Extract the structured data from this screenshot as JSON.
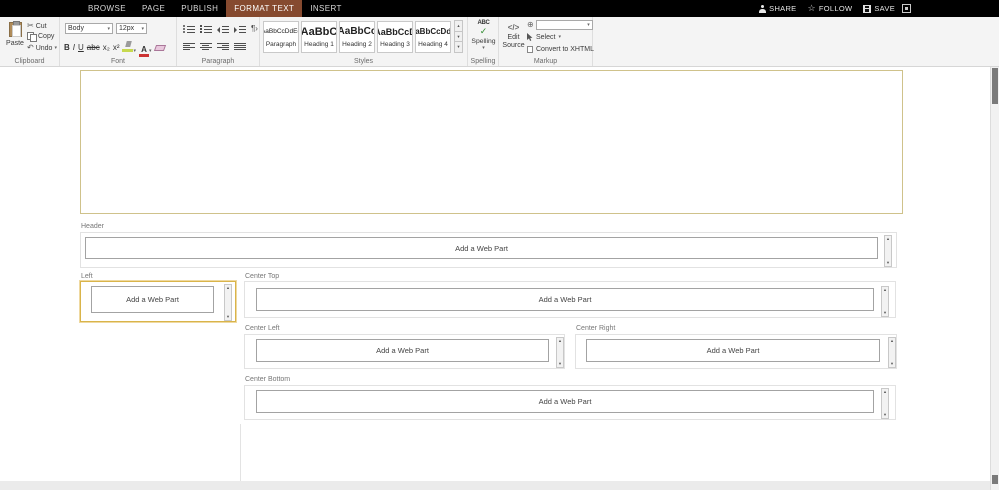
{
  "suite_bar": {
    "tabs": [
      "BROWSE",
      "PAGE",
      "PUBLISH",
      "FORMAT TEXT",
      "INSERT"
    ],
    "active_tab": "FORMAT TEXT",
    "share": "SHARE",
    "follow": "FOLLOW",
    "save": "SAVE"
  },
  "ribbon": {
    "clipboard": {
      "label": "Clipboard",
      "paste": "Paste",
      "cut": "Cut",
      "copy": "Copy",
      "undo": "Undo"
    },
    "font": {
      "label": "Font",
      "family": "Body",
      "size": "12px",
      "bold": "B",
      "italic": "I",
      "underline": "U",
      "strikethrough": "abc",
      "subscript": "x₂",
      "superscript": "x²"
    },
    "paragraph": {
      "label": "Paragraph"
    },
    "styles": {
      "label": "Styles",
      "items": [
        {
          "preview": "AaBbCcDdEe",
          "name": "Paragraph"
        },
        {
          "preview": "AaBbC",
          "name": "Heading 1"
        },
        {
          "preview": "AaBbCc",
          "name": "Heading 2"
        },
        {
          "preview": "AaBbCcD",
          "name": "Heading 3"
        },
        {
          "preview": "AaBbCcDdE",
          "name": "Heading 4"
        }
      ]
    },
    "spelling": {
      "label": "Spelling",
      "abc": "ABC",
      "button": "Spelling"
    },
    "markup": {
      "label": "Markup",
      "edit_source_line1": "Edit",
      "edit_source_line2": "Source",
      "select": "Select",
      "convert": "Convert to XHTML"
    }
  },
  "page": {
    "zones": [
      {
        "label": "Header",
        "add_label": "Add a Web Part"
      },
      {
        "label": "Left",
        "add_label": "Add a Web Part",
        "selected": true
      },
      {
        "label": "Center Top",
        "add_label": "Add a Web Part"
      },
      {
        "label": "Center Left",
        "add_label": "Add a Web Part"
      },
      {
        "label": "Center Right",
        "add_label": "Add a Web Part"
      },
      {
        "label": "Center Bottom",
        "add_label": "Add a Web Part"
      }
    ]
  },
  "icons": {
    "scissors": "✂",
    "undo": "↶",
    "caret": "▾",
    "up_arrow": "▴",
    "down_arrow": "▾",
    "check": "✓",
    "star": "☆",
    "pilcrow_ltr": "¶›",
    "pilcrow_rtl": "‹¶",
    "globe": "⊕",
    "code": "</>"
  },
  "colors": {
    "suite_bar_bg": "#000000",
    "active_tab_bg": "#864a2f",
    "selected_zone_border": "#d9b44a",
    "rte_border": "#cfc28b",
    "highlight_swatch": "#c7d94f",
    "font_color_swatch": "#cc3333",
    "spell_check_green": "#2e8b2e"
  }
}
